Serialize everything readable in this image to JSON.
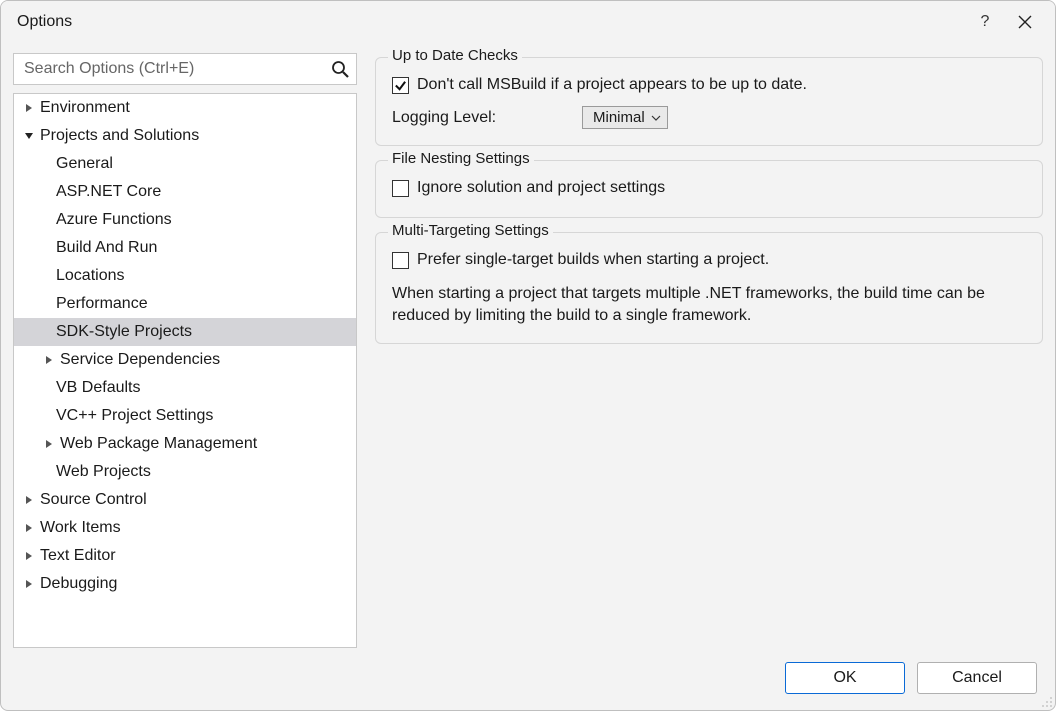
{
  "window": {
    "title": "Options",
    "help_tooltip": "?",
    "close_tooltip": "Close"
  },
  "search": {
    "placeholder": "Search Options (Ctrl+E)"
  },
  "tree": {
    "items": [
      {
        "label": "Environment",
        "depth": 0,
        "expander": "closed"
      },
      {
        "label": "Projects and Solutions",
        "depth": 0,
        "expander": "open"
      },
      {
        "label": "General",
        "depth": 1,
        "expander": "none"
      },
      {
        "label": "ASP.NET Core",
        "depth": 1,
        "expander": "none"
      },
      {
        "label": "Azure Functions",
        "depth": 1,
        "expander": "none"
      },
      {
        "label": "Build And Run",
        "depth": 1,
        "expander": "none"
      },
      {
        "label": "Locations",
        "depth": 1,
        "expander": "none"
      },
      {
        "label": "Performance",
        "depth": 1,
        "expander": "none"
      },
      {
        "label": "SDK-Style Projects",
        "depth": 1,
        "expander": "none",
        "selected": true
      },
      {
        "label": "Service Dependencies",
        "depth": 1,
        "expander": "closed"
      },
      {
        "label": "VB Defaults",
        "depth": 1,
        "expander": "none"
      },
      {
        "label": "VC++ Project Settings",
        "depth": 1,
        "expander": "none"
      },
      {
        "label": "Web Package Management",
        "depth": 1,
        "expander": "closed"
      },
      {
        "label": "Web Projects",
        "depth": 1,
        "expander": "none"
      },
      {
        "label": "Source Control",
        "depth": 0,
        "expander": "closed"
      },
      {
        "label": "Work Items",
        "depth": 0,
        "expander": "closed"
      },
      {
        "label": "Text Editor",
        "depth": 0,
        "expander": "closed"
      },
      {
        "label": "Debugging",
        "depth": 0,
        "expander": "closed"
      }
    ]
  },
  "groups": {
    "uptodate": {
      "legend": "Up to Date Checks",
      "check1_label": "Don't call MSBuild if a project appears to be up to date.",
      "check1_checked": true,
      "logging_label": "Logging Level:",
      "logging_value": "Minimal"
    },
    "filenesting": {
      "legend": "File Nesting Settings",
      "check1_label": "Ignore solution and project settings",
      "check1_checked": false
    },
    "multitarget": {
      "legend": "Multi-Targeting Settings",
      "check1_label": "Prefer single-target builds when starting a project.",
      "check1_checked": false,
      "description": "When starting a project that targets multiple .NET frameworks, the build time can be reduced by limiting the build to a single framework."
    }
  },
  "footer": {
    "ok": "OK",
    "cancel": "Cancel"
  }
}
